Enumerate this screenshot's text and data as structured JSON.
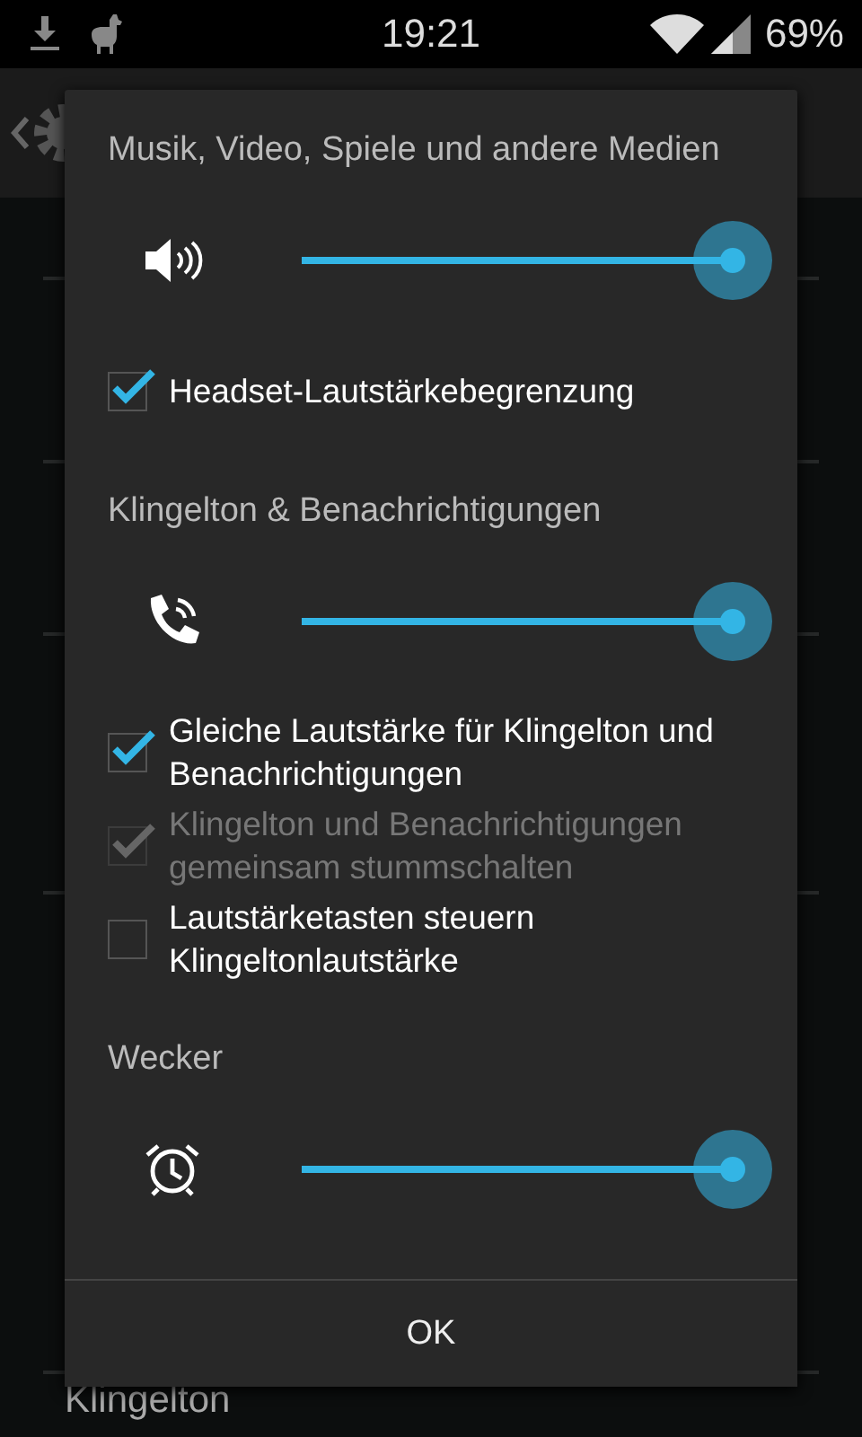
{
  "status_bar": {
    "time": "19:21",
    "battery": "69%"
  },
  "background": {
    "list_item": "Klingelton"
  },
  "dialog": {
    "sections": [
      {
        "title": "Musik, Video, Spiele und andere Medien",
        "kind": "media",
        "slider": {
          "level": 1.0
        },
        "options": [
          {
            "label": "Headset-Lautstärkebegrenzung",
            "checked": true,
            "disabled": false
          }
        ]
      },
      {
        "title": "Klingelton & Benachrichtigungen",
        "kind": "ringer",
        "slider": {
          "level": 1.0
        },
        "options": [
          {
            "label": "Gleiche Lautstärke für Klingelton und Benachrichtigungen",
            "checked": true,
            "disabled": false
          },
          {
            "label": "Klingelton und Benachrichtigungen gemeinsam stummschalten",
            "checked": true,
            "disabled": true
          },
          {
            "label": "Lautstärketasten steuern Klingeltonlautstärke",
            "checked": false,
            "disabled": false
          }
        ]
      },
      {
        "title": "Wecker",
        "kind": "alarm",
        "slider": {
          "level": 1.0
        }
      }
    ],
    "button": "OK"
  }
}
